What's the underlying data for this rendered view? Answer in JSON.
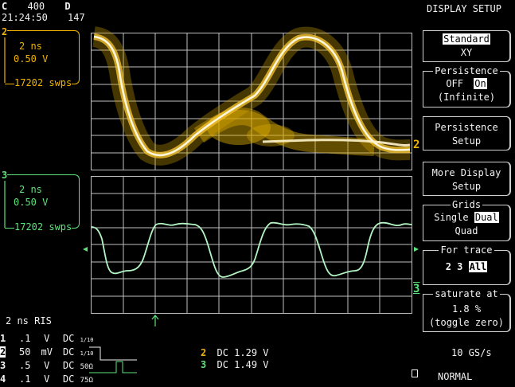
{
  "header": {
    "c_label": "C",
    "c_value": "400",
    "d_label": "D",
    "time": "21:24:50",
    "count": "147",
    "title": "DISPLAY SETUP"
  },
  "channels": {
    "ch2": {
      "number": "2",
      "timebase": "2 ns",
      "volts": "0.50 V",
      "sweeps": "17202 swps",
      "color": "#f0b400"
    },
    "ch3": {
      "number": "3",
      "timebase": "2 ns",
      "volts": "0.50 V",
      "sweeps": "17202 swps",
      "color": "#5ee37a"
    }
  },
  "trace_markers": {
    "ch2": "2",
    "ch3": "3"
  },
  "menu": {
    "display_mode": {
      "option1": "Standard",
      "option2": "XY",
      "selected": "Standard"
    },
    "persistence": {
      "title": "Persistence",
      "off": "OFF",
      "on": "On",
      "note": "(Infinite)",
      "selected": "On"
    },
    "persistence_setup": {
      "line1": "Persistence",
      "line2": "Setup"
    },
    "more_display": {
      "line1": "More Display",
      "line2": "Setup"
    },
    "grids": {
      "title": "Grids",
      "single": "Single",
      "dual": "Dual",
      "quad": "Quad",
      "selected": "Dual"
    },
    "for_trace": {
      "title": "For trace",
      "t2": "2",
      "t3": "3",
      "all": "All",
      "selected": "All"
    },
    "saturate": {
      "title": "saturate at",
      "value": "1.8 %",
      "toggle": "(toggle zero)"
    }
  },
  "bottom": {
    "timebase": "2 ns RIS",
    "ch_settings": [
      {
        "num": "1",
        "volts": ".1",
        "unit": "V",
        "coupling": "DC",
        "extra": "1/10"
      },
      {
        "num": "2",
        "volts": "50",
        "unit": "mV",
        "coupling": "DC",
        "extra": "1/10"
      },
      {
        "num": "3",
        "volts": ".5",
        "unit": "V",
        "coupling": "DC",
        "extra": "50Ω"
      },
      {
        "num": "4",
        "volts": ".1",
        "unit": "V",
        "coupling": "DC",
        "extra": "75Ω"
      }
    ],
    "readouts": [
      {
        "num": "2",
        "text": "DC 1.29 V",
        "color": "#f0b400"
      },
      {
        "num": "3",
        "text": "DC 1.49 V",
        "color": "#5ee37a"
      }
    ],
    "sample_rate": "10 GS/s",
    "trigger_mode": "NORMAL"
  },
  "colors": {
    "grid": "#bfbfbf",
    "trace2": "#f0b400",
    "trace3": "#a8f0b8",
    "trace2_core": "#fff6d0"
  }
}
